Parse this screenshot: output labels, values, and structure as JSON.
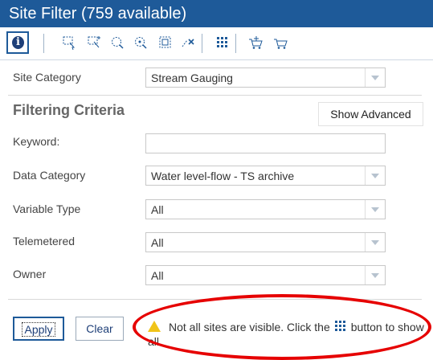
{
  "title": "Site Filter (759 available)",
  "toolbar": {
    "tools": [
      {
        "icon": "info-icon"
      },
      {
        "icon": "select-rectangle-icon"
      },
      {
        "icon": "select-rectangle-add-icon"
      },
      {
        "icon": "select-lasso-icon"
      },
      {
        "icon": "select-radius-icon"
      },
      {
        "icon": "select-grid-icon"
      },
      {
        "icon": "clear-selection-icon"
      },
      {
        "icon": "show-all-sites-icon"
      },
      {
        "icon": "add-to-cart-icon"
      },
      {
        "icon": "cart-icon"
      }
    ]
  },
  "site_category": {
    "label": "Site Category",
    "value": "Stream Gauging"
  },
  "filtering": {
    "heading": "Filtering Criteria",
    "show_advanced": "Show Advanced",
    "keyword_label": "Keyword:",
    "keyword_value": "",
    "data_category": {
      "label": "Data Category",
      "value": "Water level-flow - TS archive"
    },
    "variable_type": {
      "label": "Variable Type",
      "value": "All"
    },
    "telemetered": {
      "label": "Telemetered",
      "value": "All"
    },
    "owner": {
      "label": "Owner",
      "value": "All"
    }
  },
  "buttons": {
    "apply": "Apply",
    "clear": "Clear"
  },
  "notice": {
    "part1": "Not all sites are visible. Click the",
    "part2": "button to show all.",
    "highlight_color": "#e60000"
  },
  "colors": {
    "title_bg": "#1e5a99",
    "icon": "#1e5a99"
  }
}
